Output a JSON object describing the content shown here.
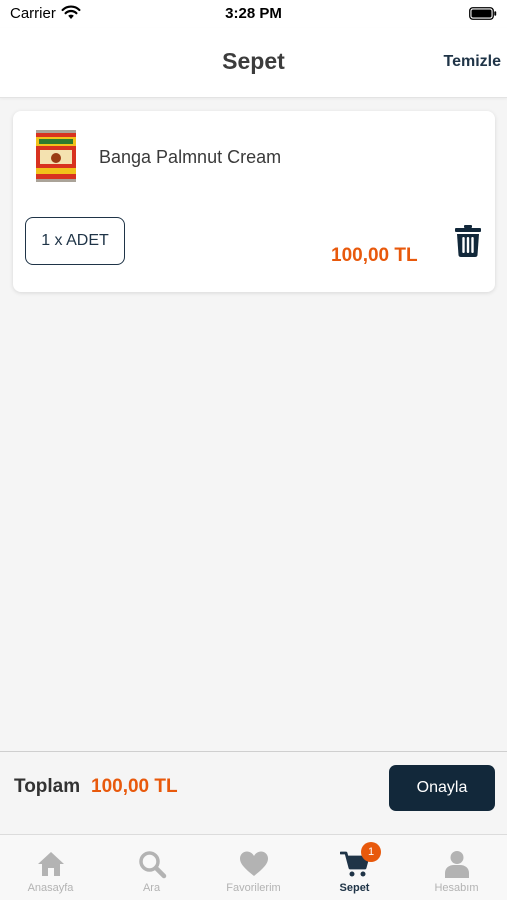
{
  "status_bar": {
    "carrier": "Carrier",
    "time": "3:28 PM"
  },
  "nav": {
    "title": "Sepet",
    "action": "Temizle"
  },
  "cart": {
    "items": [
      {
        "name": "Banga Palmnut Cream",
        "quantity": "1 x ADET",
        "price": "100,00 TL",
        "thumb_icon": "product-can-icon"
      }
    ]
  },
  "footer": {
    "total_label": "Toplam",
    "total_value": "100,00 TL",
    "confirm_label": "Onayla"
  },
  "tabs": [
    {
      "label": "Anasayfa",
      "icon": "home-icon",
      "active": false
    },
    {
      "label": "Ara",
      "icon": "search-icon",
      "active": false
    },
    {
      "label": "Favorilerim",
      "icon": "heart-icon",
      "active": false
    },
    {
      "label": "Sepet",
      "icon": "cart-icon",
      "active": true,
      "badge": "1"
    },
    {
      "label": "Hesabım",
      "icon": "user-icon",
      "active": false
    }
  ],
  "colors": {
    "accent": "#e8590c",
    "primary": "#12283a",
    "text_dark": "#1f3447",
    "inactive": "#b3b3b3"
  }
}
